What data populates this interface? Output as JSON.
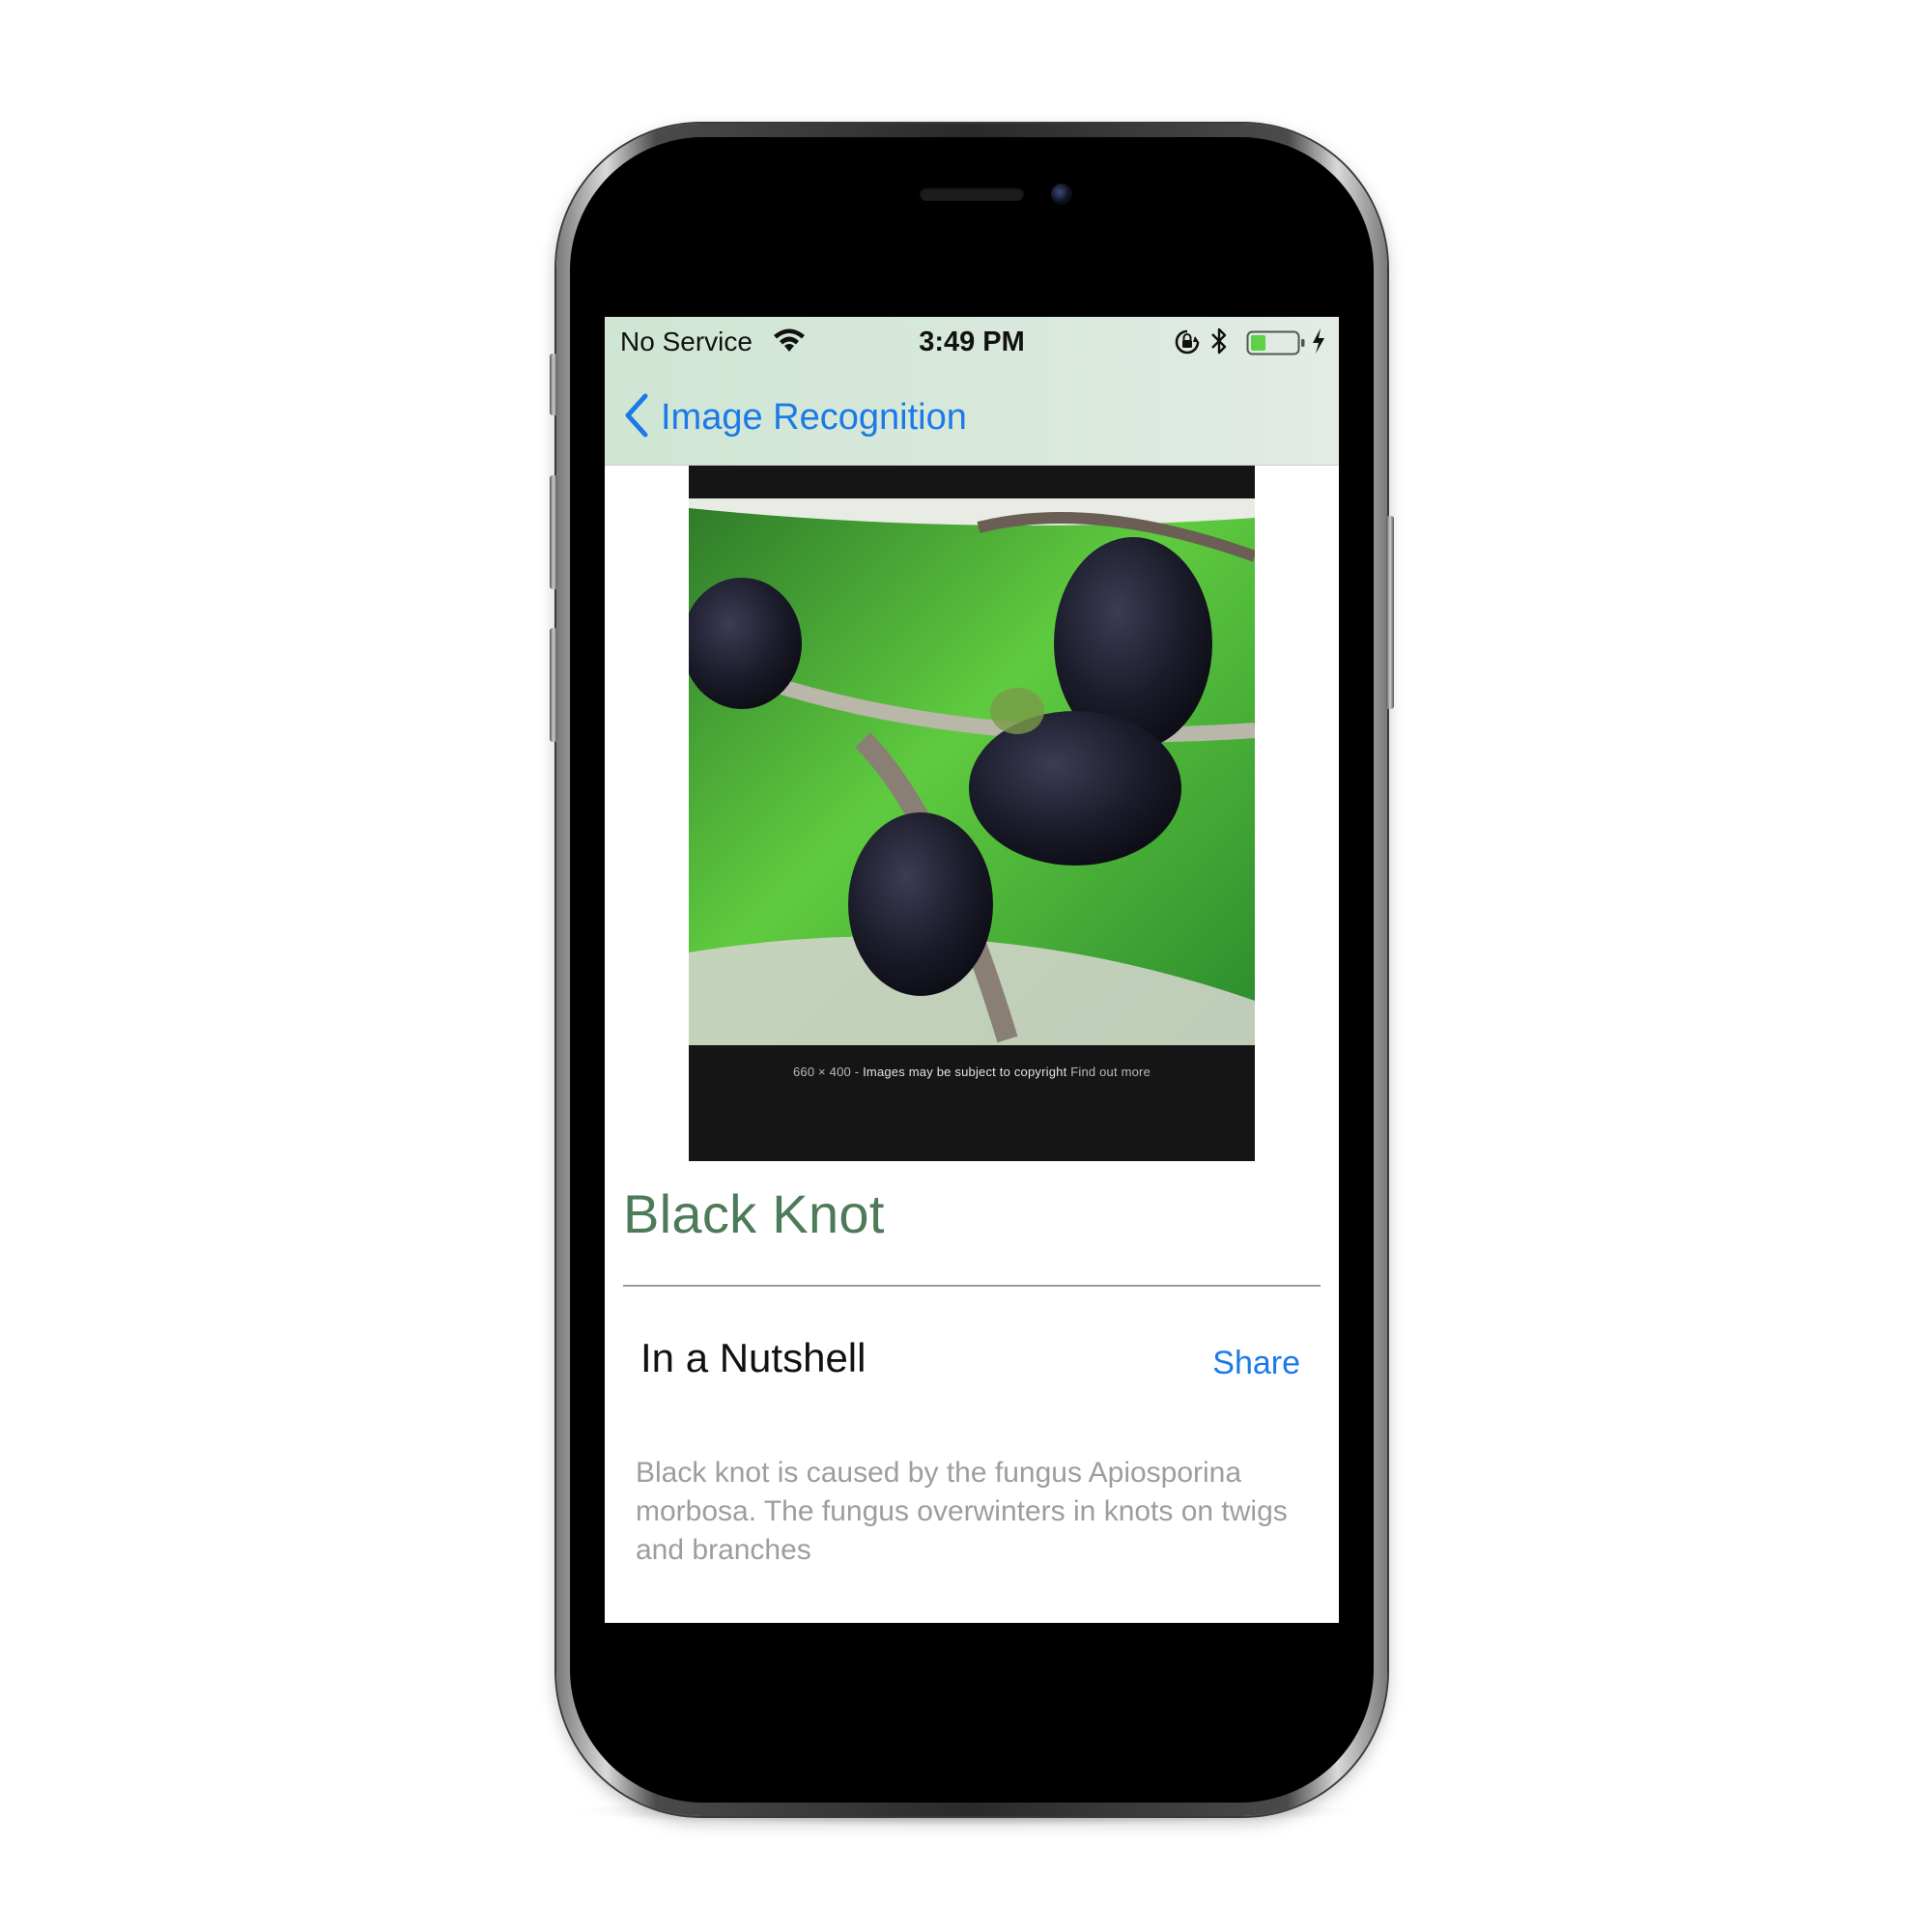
{
  "status_bar": {
    "carrier": "No Service",
    "time": "3:49 PM"
  },
  "nav": {
    "back_label": "Image Recognition"
  },
  "hero_image": {
    "caption_size": "660 × 400",
    "caption_separator": "-",
    "caption_copyright": "Images may be subject to copyright",
    "caption_link": "Find out more"
  },
  "result": {
    "title": "Black Knot"
  },
  "section": {
    "title": "In a Nutshell",
    "share_label": "Share",
    "description": "Black knot is caused by the fungus Apiosporina morbosa. The fungus overwinters in knots on twigs and branches"
  },
  "colors": {
    "accent_blue": "#1b7ae8",
    "title_green": "#4d7b59",
    "nav_background": "#d3e7d8",
    "description_gray": "#9d9d9d"
  },
  "icons": [
    "wifi-icon",
    "orientation-lock-icon",
    "bluetooth-icon",
    "battery-icon",
    "charging-icon",
    "chevron-left-icon"
  ]
}
